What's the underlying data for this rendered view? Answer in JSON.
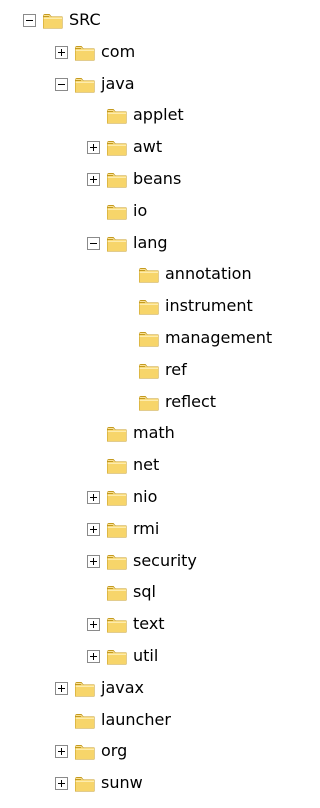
{
  "tree": {
    "nodes": [
      {
        "label": "SRC",
        "depth": 0,
        "toggle": "minus"
      },
      {
        "label": "com",
        "depth": 1,
        "toggle": "plus"
      },
      {
        "label": "java",
        "depth": 1,
        "toggle": "minus"
      },
      {
        "label": "applet",
        "depth": 2,
        "toggle": "none"
      },
      {
        "label": "awt",
        "depth": 2,
        "toggle": "plus"
      },
      {
        "label": "beans",
        "depth": 2,
        "toggle": "plus"
      },
      {
        "label": "io",
        "depth": 2,
        "toggle": "none"
      },
      {
        "label": "lang",
        "depth": 2,
        "toggle": "minus"
      },
      {
        "label": "annotation",
        "depth": 3,
        "toggle": "none"
      },
      {
        "label": "instrument",
        "depth": 3,
        "toggle": "none"
      },
      {
        "label": "management",
        "depth": 3,
        "toggle": "none"
      },
      {
        "label": "ref",
        "depth": 3,
        "toggle": "none"
      },
      {
        "label": "reflect",
        "depth": 3,
        "toggle": "none"
      },
      {
        "label": "math",
        "depth": 2,
        "toggle": "none"
      },
      {
        "label": "net",
        "depth": 2,
        "toggle": "none"
      },
      {
        "label": "nio",
        "depth": 2,
        "toggle": "plus"
      },
      {
        "label": "rmi",
        "depth": 2,
        "toggle": "plus"
      },
      {
        "label": "security",
        "depth": 2,
        "toggle": "plus"
      },
      {
        "label": "sql",
        "depth": 2,
        "toggle": "none"
      },
      {
        "label": "text",
        "depth": 2,
        "toggle": "plus"
      },
      {
        "label": "util",
        "depth": 2,
        "toggle": "plus"
      },
      {
        "label": "javax",
        "depth": 1,
        "toggle": "plus"
      },
      {
        "label": "launcher",
        "depth": 1,
        "toggle": "none"
      },
      {
        "label": "org",
        "depth": 1,
        "toggle": "plus"
      },
      {
        "label": "sunw",
        "depth": 1,
        "toggle": "plus"
      }
    ]
  },
  "icons": {
    "toggle_expanded": "minus-box-icon",
    "toggle_collapsed": "plus-box-icon",
    "folder": "folder-icon"
  },
  "colors": {
    "folder_fill": "#f7d56a",
    "folder_edge": "#c49a1e",
    "toggle_border": "#8a8a8a"
  }
}
